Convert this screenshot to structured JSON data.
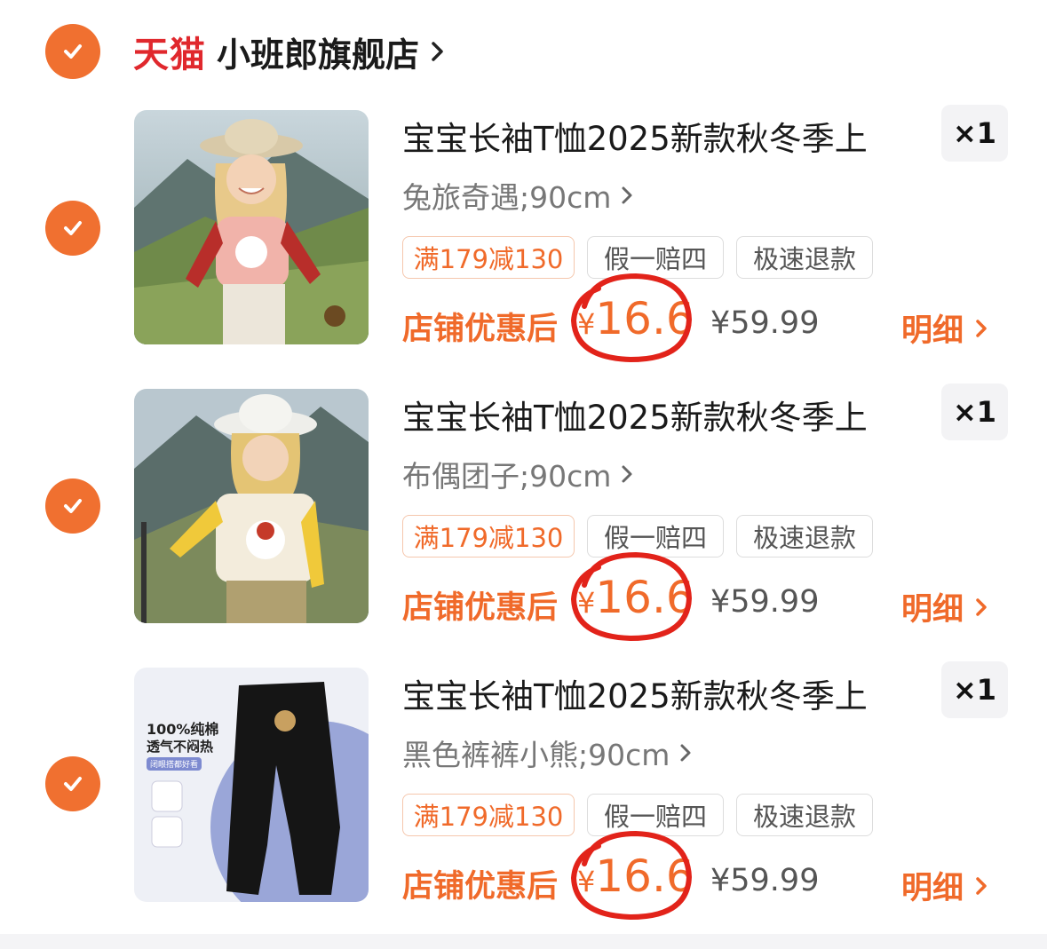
{
  "store": {
    "platform_label": "天猫",
    "name": "小班郎旗舰店",
    "brand_color": "#e0282d",
    "accent_color": "#f06a2a",
    "checked": true
  },
  "items": [
    {
      "title": "宝宝长袖T恤2025新款秋冬季上",
      "sku": "兔旅奇遇;90cm",
      "qty": "×1",
      "tags": [
        "满179减130",
        "假一赔四",
        "极速退款"
      ],
      "after_label": "店铺优惠后",
      "currency": "¥",
      "price_now": "16.6",
      "price_orig": "¥59.99",
      "detail_label": "明细",
      "checked": true
    },
    {
      "title": "宝宝长袖T恤2025新款秋冬季上",
      "sku": "布偶团子;90cm",
      "qty": "×1",
      "tags": [
        "满179减130",
        "假一赔四",
        "极速退款"
      ],
      "after_label": "店铺优惠后",
      "currency": "¥",
      "price_now": "16.6",
      "price_orig": "¥59.99",
      "detail_label": "明细",
      "checked": true
    },
    {
      "title": "宝宝长袖T恤2025新款秋冬季上",
      "sku": "黑色裤裤小熊;90cm",
      "qty": "×1",
      "tags": [
        "满179减130",
        "假一赔四",
        "极速退款"
      ],
      "after_label": "店铺优惠后",
      "currency": "¥",
      "price_now": "16.6",
      "price_orig": "¥59.99",
      "detail_label": "明细",
      "checked": true,
      "image_text": {
        "line1": "100%纯棉",
        "line2": "透气不闷热",
        "badge": "闭眼搭都好看"
      }
    }
  ]
}
